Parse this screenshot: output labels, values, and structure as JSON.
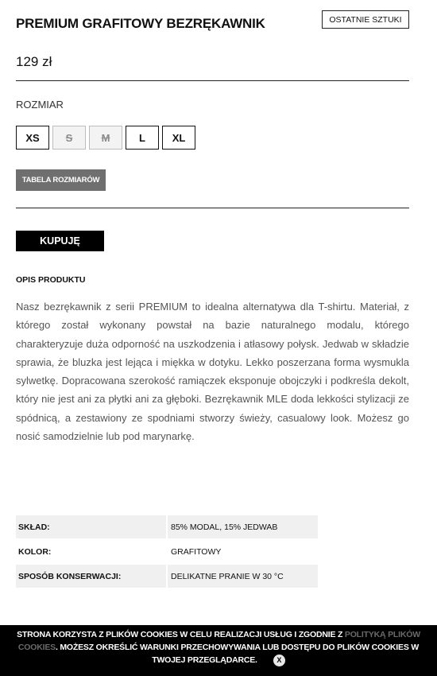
{
  "product": {
    "title": "PREMIUM GRAFITOWY BEZRĘKAWNIK",
    "badge": "OSTATNIE SZTUKI",
    "price": "129 zł"
  },
  "sizes": {
    "label": "ROZMIAR",
    "options": [
      {
        "label": "XS",
        "available": true
      },
      {
        "label": "S",
        "available": false
      },
      {
        "label": "M",
        "available": false
      },
      {
        "label": "L",
        "available": true
      },
      {
        "label": "XL",
        "available": true
      }
    ],
    "size_table_label": "TABELA ROZMIARÓW"
  },
  "buy_label": "KUPUJĘ",
  "description": {
    "heading": "OPIS PRODUKTU",
    "text": "Nasz bezrękawnik z serii PREMIUM to idealna alternatywa dla T-shirtu. Materiał, z którego został wykonany powstał na bazie naturalnego modalu, którego charakteryzuje duża odporność na uszkodzenia i atłasowy połysk. Jedwab w składzie sprawia, że bluzka jest lejąca i miękka w dotyku. Lekko poszerzana forma wysmukla sylwetkę. Dopracowana szerokość ramiączek eksponuje obojczyki i podkreśla dekolt, który nie jest ani za płytki ani za głęboki. Bezrękawnik MLE doda lekkości stylizacji ze spódnicą, a zestawiony ze spodniami stworzy świeży, casualowy look. Możesz go nosić samodzielnie lub pod marynarkę."
  },
  "specs": [
    {
      "key": "SKŁAD:",
      "value": "85% MODAL, 15% JEDWAB"
    },
    {
      "key": "KOLOR:",
      "value": "GRAFITOWY"
    },
    {
      "key": "SPOSÓB KONSERWACJI:",
      "value": "DELIKATNE PRANIE W 30 °C"
    }
  ],
  "cookie": {
    "text_before": "STRONA KORZYSTA Z PLIKÓW COOKIES W CELU REALIZACJI USŁUG I ZGODNIE Z ",
    "link": "POLITYKĄ PLIKÓW COOKIES",
    "text_after": ". MOŻESZ OKREŚLIĆ WARUNKI PRZECHOWYWANIA LUB DOSTĘPU DO PLIKÓW COOKIES W TWOJEJ PRZEGLĄDARCE.",
    "close": "X"
  },
  "colors": {
    "primary": "#000000",
    "size_table_button": "#6f6f6f",
    "spec_row_shade": "#f0f0f0",
    "cookie_link": "#6a6a6a"
  }
}
